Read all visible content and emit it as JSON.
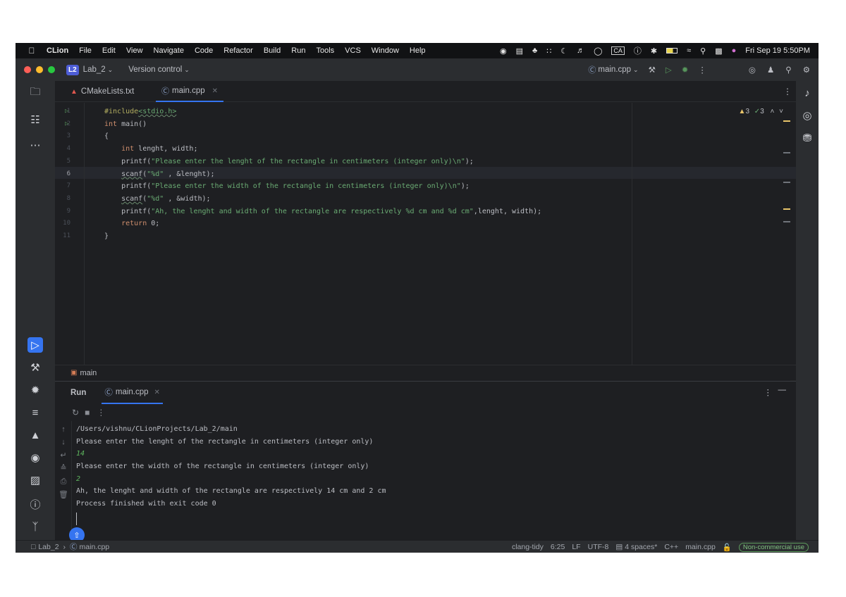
{
  "menubar": {
    "app_name": "CLion",
    "items": [
      "File",
      "Edit",
      "View",
      "Navigate",
      "Code",
      "Refactor",
      "Build",
      "Run",
      "Tools",
      "VCS",
      "Window",
      "Help"
    ],
    "clock": "Fri Sep 19 5:50PM",
    "input_source": "CA"
  },
  "titlebar": {
    "project_badge": "L2",
    "project_name": "Lab_2",
    "vcs_label": "Version control",
    "run_config": "main.cpp"
  },
  "tabs": [
    {
      "label": "CMakeLists.txt",
      "icon": "cmake-icon"
    },
    {
      "label": "main.cpp",
      "icon": "cpp-file-icon"
    }
  ],
  "editor": {
    "inspections": {
      "warnings": "3",
      "weak_warnings": "3"
    },
    "lines": [
      {
        "n": "1",
        "text": "#include<stdio.h>"
      },
      {
        "n": "2",
        "text": "int main()"
      },
      {
        "n": "3",
        "text": "{"
      },
      {
        "n": "4",
        "text": "    int lenght, width;"
      },
      {
        "n": "5",
        "text": "    printf(\"Please enter the lenght of the rectangle in centimeters (integer only)\\n\");"
      },
      {
        "n": "6",
        "text": "    scanf(\"%d\" , &lenght);"
      },
      {
        "n": "7",
        "text": "    printf(\"Please enter the width of the rectangle in centimeters (integer only)\\n\");"
      },
      {
        "n": "8",
        "text": "    scanf(\"%d\" , &width);"
      },
      {
        "n": "9",
        "text": "    printf(\"Ah, the lenght and width of the rectangle are respectively %d cm and %d cm\",lenght, width);"
      },
      {
        "n": "10",
        "text": "    return 0;"
      },
      {
        "n": "11",
        "text": "}"
      }
    ]
  },
  "breadcrumb": {
    "label": "main"
  },
  "run_panel": {
    "title": "Run",
    "tab_label": "main.cpp",
    "console": [
      {
        "text": "/Users/vishnu/CLionProjects/Lab_2/main",
        "type": "out"
      },
      {
        "text": "Please enter the lenght of the rectangle in centimeters (integer only)",
        "type": "out"
      },
      {
        "text": "14",
        "type": "in"
      },
      {
        "text": "Please enter the width of the rectangle in centimeters (integer only)",
        "type": "out"
      },
      {
        "text": "2",
        "type": "in"
      },
      {
        "text": "Ah, the lenght and width of the rectangle are respectively 14 cm and 2 cm",
        "type": "out"
      },
      {
        "text": "Process finished with exit code 0",
        "type": "out"
      }
    ]
  },
  "statusbar": {
    "path_project": "Lab_2",
    "path_file": "main.cpp",
    "linter": "clang-tidy",
    "position": "6:25",
    "line_sep": "LF",
    "encoding": "UTF-8",
    "indent": "4 spaces*",
    "language": "C++",
    "context": "main.cpp",
    "license": "Non-commercial use"
  },
  "colors": {
    "accent": "#3574f0",
    "background": "#1e1f22",
    "panel": "#2b2d30"
  }
}
